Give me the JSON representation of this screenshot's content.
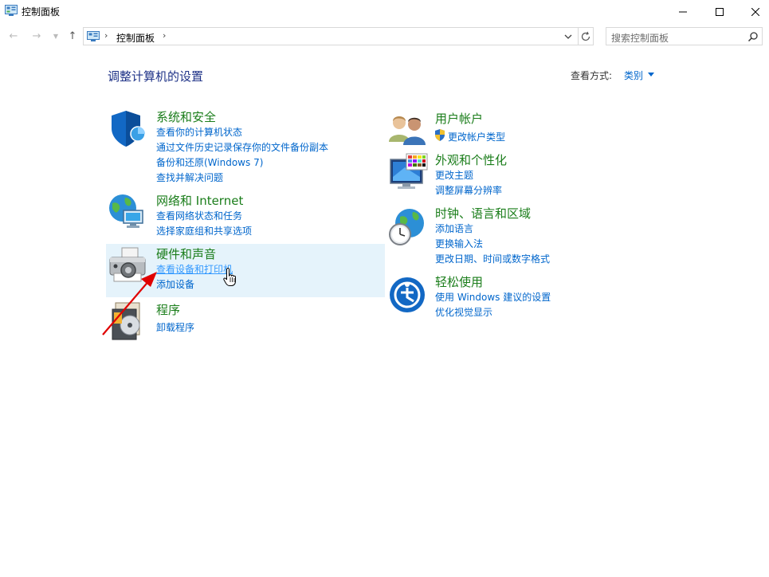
{
  "window": {
    "title": "控制面板"
  },
  "address": {
    "crumb": "控制面板",
    "search_placeholder": "搜索控制面板"
  },
  "header": {
    "heading": "调整计算机的设置",
    "view_by_label": "查看方式:",
    "view_by_value": "类别"
  },
  "categories_left": [
    {
      "title": "系统和安全",
      "icon": "shield-icon",
      "links": [
        "查看你的计算机状态",
        "通过文件历史记录保存你的文件备份副本",
        "备份和还原(Windows 7)",
        "查找并解决问题"
      ]
    },
    {
      "title": "网络和 Internet",
      "icon": "network-globe-icon",
      "links": [
        "查看网络状态和任务",
        "选择家庭组和共享选项"
      ]
    },
    {
      "title": "硬件和声音",
      "icon": "printer-icon",
      "links": [
        "查看设备和打印机",
        "添加设备"
      ]
    },
    {
      "title": "程序",
      "icon": "programs-disc-icon",
      "links": [
        "卸载程序"
      ]
    }
  ],
  "categories_right": [
    {
      "title": "用户帐户",
      "icon": "users-icon",
      "links": [
        "更改帐户类型"
      ]
    },
    {
      "title": "外观和个性化",
      "icon": "monitor-palette-icon",
      "links": [
        "更改主题",
        "调整屏幕分辨率"
      ]
    },
    {
      "title": "时钟、语言和区域",
      "icon": "globe-clock-icon",
      "links": [
        "添加语言",
        "更换输入法",
        "更改日期、时间或数字格式"
      ]
    },
    {
      "title": "轻松使用",
      "icon": "ease-of-access-icon",
      "links": [
        "使用 Windows 建议的设置",
        "优化视觉显示"
      ]
    }
  ],
  "colors": {
    "category_title": "#1a7d1a",
    "link": "#0066cc",
    "heading": "#1e3287",
    "hover": "#e5f3fb",
    "annotation_arrow": "#e00000"
  }
}
